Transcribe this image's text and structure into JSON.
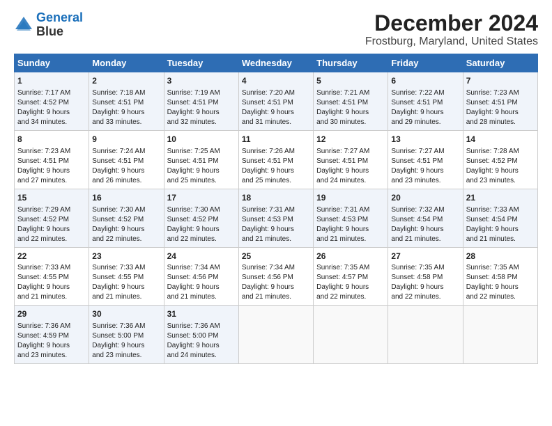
{
  "header": {
    "logo_line1": "General",
    "logo_line2": "Blue",
    "title": "December 2024",
    "subtitle": "Frostburg, Maryland, United States"
  },
  "calendar": {
    "days_of_week": [
      "Sunday",
      "Monday",
      "Tuesday",
      "Wednesday",
      "Thursday",
      "Friday",
      "Saturday"
    ],
    "weeks": [
      [
        {
          "day": "1",
          "lines": [
            "Sunrise: 7:17 AM",
            "Sunset: 4:52 PM",
            "Daylight: 9 hours",
            "and 34 minutes."
          ]
        },
        {
          "day": "2",
          "lines": [
            "Sunrise: 7:18 AM",
            "Sunset: 4:51 PM",
            "Daylight: 9 hours",
            "and 33 minutes."
          ]
        },
        {
          "day": "3",
          "lines": [
            "Sunrise: 7:19 AM",
            "Sunset: 4:51 PM",
            "Daylight: 9 hours",
            "and 32 minutes."
          ]
        },
        {
          "day": "4",
          "lines": [
            "Sunrise: 7:20 AM",
            "Sunset: 4:51 PM",
            "Daylight: 9 hours",
            "and 31 minutes."
          ]
        },
        {
          "day": "5",
          "lines": [
            "Sunrise: 7:21 AM",
            "Sunset: 4:51 PM",
            "Daylight: 9 hours",
            "and 30 minutes."
          ]
        },
        {
          "day": "6",
          "lines": [
            "Sunrise: 7:22 AM",
            "Sunset: 4:51 PM",
            "Daylight: 9 hours",
            "and 29 minutes."
          ]
        },
        {
          "day": "7",
          "lines": [
            "Sunrise: 7:23 AM",
            "Sunset: 4:51 PM",
            "Daylight: 9 hours",
            "and 28 minutes."
          ]
        }
      ],
      [
        {
          "day": "8",
          "lines": [
            "Sunrise: 7:23 AM",
            "Sunset: 4:51 PM",
            "Daylight: 9 hours",
            "and 27 minutes."
          ]
        },
        {
          "day": "9",
          "lines": [
            "Sunrise: 7:24 AM",
            "Sunset: 4:51 PM",
            "Daylight: 9 hours",
            "and 26 minutes."
          ]
        },
        {
          "day": "10",
          "lines": [
            "Sunrise: 7:25 AM",
            "Sunset: 4:51 PM",
            "Daylight: 9 hours",
            "and 25 minutes."
          ]
        },
        {
          "day": "11",
          "lines": [
            "Sunrise: 7:26 AM",
            "Sunset: 4:51 PM",
            "Daylight: 9 hours",
            "and 25 minutes."
          ]
        },
        {
          "day": "12",
          "lines": [
            "Sunrise: 7:27 AM",
            "Sunset: 4:51 PM",
            "Daylight: 9 hours",
            "and 24 minutes."
          ]
        },
        {
          "day": "13",
          "lines": [
            "Sunrise: 7:27 AM",
            "Sunset: 4:51 PM",
            "Daylight: 9 hours",
            "and 23 minutes."
          ]
        },
        {
          "day": "14",
          "lines": [
            "Sunrise: 7:28 AM",
            "Sunset: 4:52 PM",
            "Daylight: 9 hours",
            "and 23 minutes."
          ]
        }
      ],
      [
        {
          "day": "15",
          "lines": [
            "Sunrise: 7:29 AM",
            "Sunset: 4:52 PM",
            "Daylight: 9 hours",
            "and 22 minutes."
          ]
        },
        {
          "day": "16",
          "lines": [
            "Sunrise: 7:30 AM",
            "Sunset: 4:52 PM",
            "Daylight: 9 hours",
            "and 22 minutes."
          ]
        },
        {
          "day": "17",
          "lines": [
            "Sunrise: 7:30 AM",
            "Sunset: 4:52 PM",
            "Daylight: 9 hours",
            "and 22 minutes."
          ]
        },
        {
          "day": "18",
          "lines": [
            "Sunrise: 7:31 AM",
            "Sunset: 4:53 PM",
            "Daylight: 9 hours",
            "and 21 minutes."
          ]
        },
        {
          "day": "19",
          "lines": [
            "Sunrise: 7:31 AM",
            "Sunset: 4:53 PM",
            "Daylight: 9 hours",
            "and 21 minutes."
          ]
        },
        {
          "day": "20",
          "lines": [
            "Sunrise: 7:32 AM",
            "Sunset: 4:54 PM",
            "Daylight: 9 hours",
            "and 21 minutes."
          ]
        },
        {
          "day": "21",
          "lines": [
            "Sunrise: 7:33 AM",
            "Sunset: 4:54 PM",
            "Daylight: 9 hours",
            "and 21 minutes."
          ]
        }
      ],
      [
        {
          "day": "22",
          "lines": [
            "Sunrise: 7:33 AM",
            "Sunset: 4:55 PM",
            "Daylight: 9 hours",
            "and 21 minutes."
          ]
        },
        {
          "day": "23",
          "lines": [
            "Sunrise: 7:33 AM",
            "Sunset: 4:55 PM",
            "Daylight: 9 hours",
            "and 21 minutes."
          ]
        },
        {
          "day": "24",
          "lines": [
            "Sunrise: 7:34 AM",
            "Sunset: 4:56 PM",
            "Daylight: 9 hours",
            "and 21 minutes."
          ]
        },
        {
          "day": "25",
          "lines": [
            "Sunrise: 7:34 AM",
            "Sunset: 4:56 PM",
            "Daylight: 9 hours",
            "and 21 minutes."
          ]
        },
        {
          "day": "26",
          "lines": [
            "Sunrise: 7:35 AM",
            "Sunset: 4:57 PM",
            "Daylight: 9 hours",
            "and 22 minutes."
          ]
        },
        {
          "day": "27",
          "lines": [
            "Sunrise: 7:35 AM",
            "Sunset: 4:58 PM",
            "Daylight: 9 hours",
            "and 22 minutes."
          ]
        },
        {
          "day": "28",
          "lines": [
            "Sunrise: 7:35 AM",
            "Sunset: 4:58 PM",
            "Daylight: 9 hours",
            "and 22 minutes."
          ]
        }
      ],
      [
        {
          "day": "29",
          "lines": [
            "Sunrise: 7:36 AM",
            "Sunset: 4:59 PM",
            "Daylight: 9 hours",
            "and 23 minutes."
          ]
        },
        {
          "day": "30",
          "lines": [
            "Sunrise: 7:36 AM",
            "Sunset: 5:00 PM",
            "Daylight: 9 hours",
            "and 23 minutes."
          ]
        },
        {
          "day": "31",
          "lines": [
            "Sunrise: 7:36 AM",
            "Sunset: 5:00 PM",
            "Daylight: 9 hours",
            "and 24 minutes."
          ]
        },
        null,
        null,
        null,
        null
      ]
    ]
  }
}
